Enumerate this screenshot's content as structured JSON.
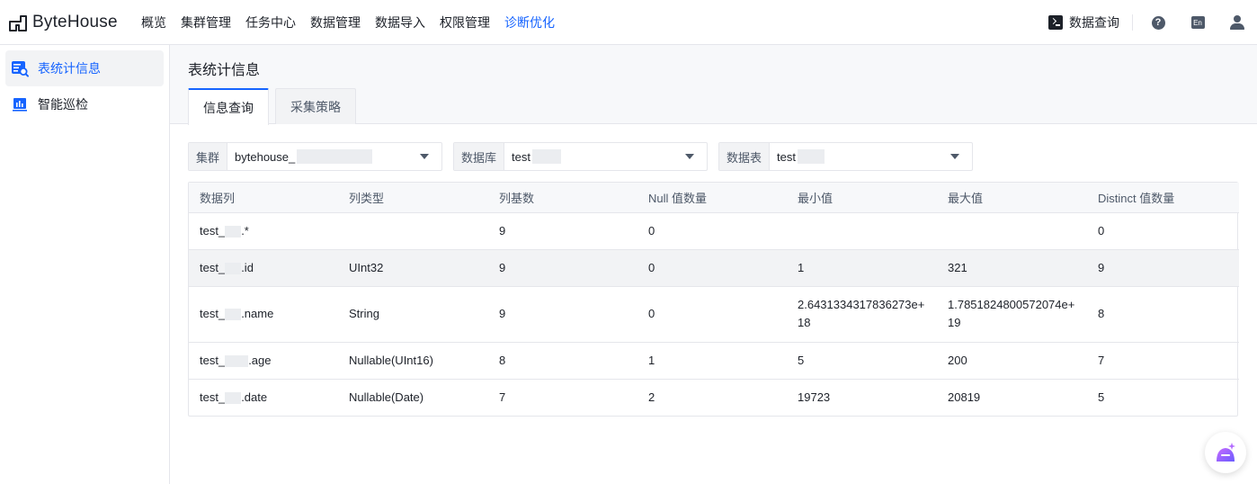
{
  "app": {
    "logo_text": "ByteHouse"
  },
  "nav": {
    "items": [
      {
        "label": "概览"
      },
      {
        "label": "集群管理"
      },
      {
        "label": "任务中心"
      },
      {
        "label": "数据管理"
      },
      {
        "label": "数据导入"
      },
      {
        "label": "权限管理"
      },
      {
        "label": "诊断优化",
        "active": true
      }
    ],
    "query_label": "数据查询",
    "help_icon": "question-circle-icon",
    "lang_label": "En",
    "user_icon": "user-icon"
  },
  "sidebar": {
    "items": [
      {
        "label": "表统计信息",
        "icon": "table-search-icon",
        "active": true
      },
      {
        "label": "智能巡检",
        "icon": "bar-chart-icon"
      }
    ]
  },
  "page": {
    "title": "表统计信息",
    "tabs": [
      {
        "label": "信息查询",
        "active": true
      },
      {
        "label": "采集策略"
      }
    ]
  },
  "filters": [
    {
      "label": "集群",
      "value": "bytehouse_"
    },
    {
      "label": "数据库",
      "value": "test"
    },
    {
      "label": "数据表",
      "value": "test"
    }
  ],
  "table": {
    "headers": [
      "数据列",
      "列类型",
      "列基数",
      "Null 值数量",
      "最小值",
      "最大值",
      "Distinct 值数量"
    ],
    "rows": [
      {
        "col_prefix": "test_",
        "col_suffix": ".*",
        "type": "",
        "cardinality": "9",
        "nulls": "0",
        "min": "",
        "max": "",
        "distinct": "0"
      },
      {
        "col_prefix": "test_",
        "col_suffix": ".id",
        "type": "UInt32",
        "cardinality": "9",
        "nulls": "0",
        "min": "1",
        "max": "321",
        "distinct": "9",
        "hover": true
      },
      {
        "col_prefix": "test_",
        "col_suffix": ".name",
        "type": "String",
        "cardinality": "9",
        "nulls": "0",
        "min": "2.6431334317836273e+18",
        "max": "1.7851824800572074e+19",
        "distinct": "8"
      },
      {
        "col_prefix": "test_",
        "col_suffix": ".age",
        "type": "Nullable(UInt16)",
        "cardinality": "8",
        "nulls": "1",
        "min": "5",
        "max": "200",
        "distinct": "7"
      },
      {
        "col_prefix": "test_",
        "col_suffix": ".date",
        "type": "Nullable(Date)",
        "cardinality": "7",
        "nulls": "2",
        "min": "19723",
        "max": "20819",
        "distinct": "5"
      }
    ]
  },
  "colors": {
    "accent": "#1664ff",
    "text": "#1d2129",
    "muted": "#4e5969",
    "border": "#e5e6eb"
  }
}
